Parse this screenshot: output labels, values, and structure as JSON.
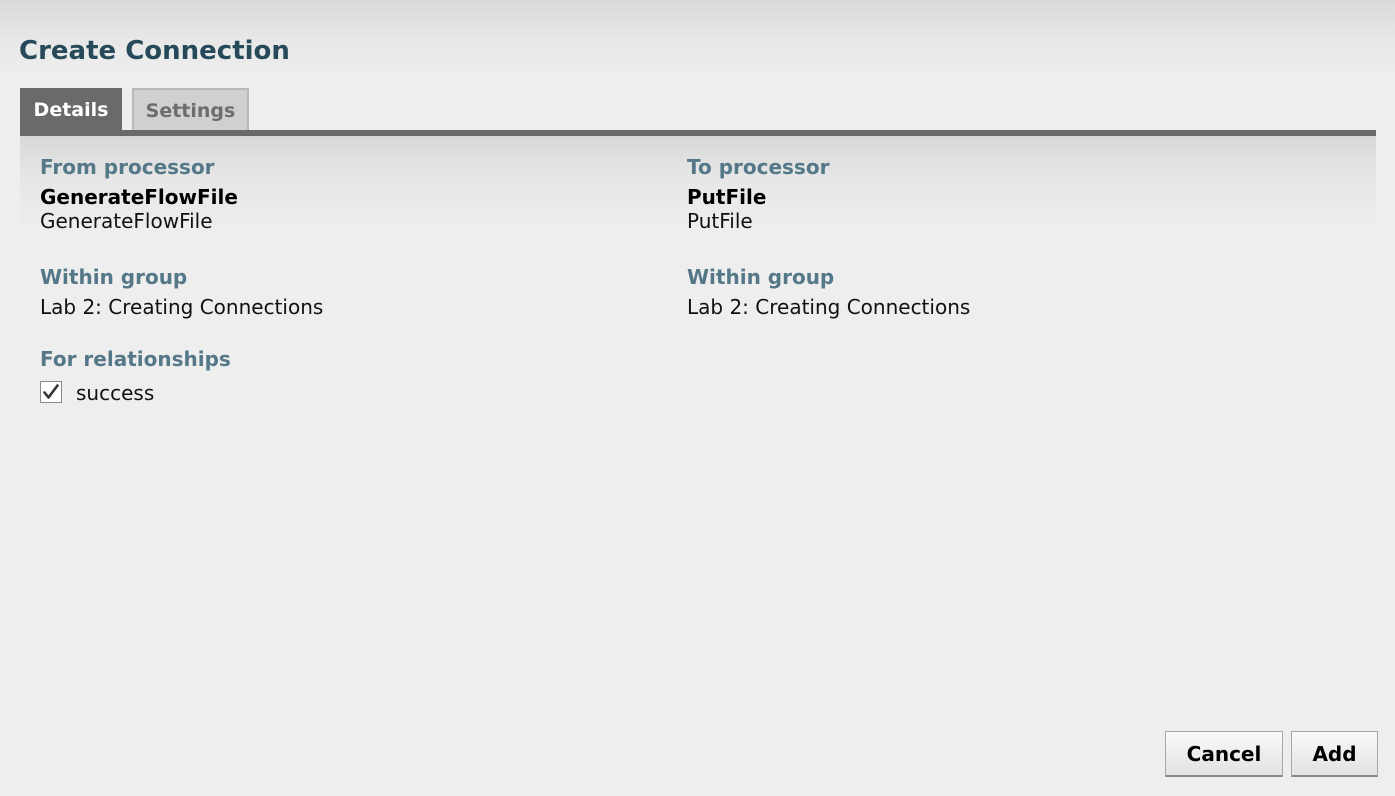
{
  "dialog": {
    "title": "Create Connection"
  },
  "tabs": [
    {
      "label": "Details",
      "active": true
    },
    {
      "label": "Settings",
      "active": false
    }
  ],
  "source": {
    "heading": "From processor",
    "name": "GenerateFlowFile",
    "type": "GenerateFlowFile",
    "group_heading": "Within group",
    "group": "Lab 2: Creating Connections"
  },
  "destination": {
    "heading": "To processor",
    "name": "PutFile",
    "type": "PutFile",
    "group_heading": "Within group",
    "group": "Lab 2: Creating Connections"
  },
  "relationships": {
    "heading": "For relationships",
    "items": [
      {
        "label": "success",
        "checked": true
      }
    ]
  },
  "buttons": {
    "cancel": "Cancel",
    "add": "Add"
  },
  "colors": {
    "title": "#264a5a",
    "label": "#557889",
    "tab_active_bg": "#6a6a6a",
    "tab_inactive_bg": "#d0d0d0"
  },
  "icons": {
    "checkbox": "check-icon"
  }
}
